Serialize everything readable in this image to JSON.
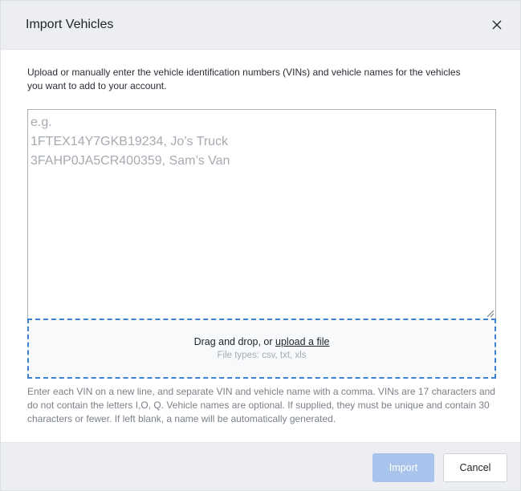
{
  "dialog": {
    "title": "Import Vehicles",
    "close_icon": "close-icon",
    "intro_text": "Upload or manually enter the vehicle identification numbers (VINs) and vehicle names for the vehicles you want to add to your account.",
    "vin_input": {
      "value": "",
      "placeholder": "e.g.\n1FTEX14Y7GKB19234, Jo’s Truck\n3FAHP0JA5CR400359, Sam’s Van"
    },
    "dropzone": {
      "prefix": "Drag and drop, or ",
      "link_label": "upload a file",
      "file_types": "File types: csv, txt, xls"
    },
    "help_text": "Enter each VIN on a new line, and separate VIN and vehicle name with a comma. VINs are 17 characters and do not contain the letters I,O, Q. Vehicle names are optional. If supplied, they must be unique and contain 30 characters or fewer. If left blank, a name will be automatically generated.",
    "footer": {
      "import_label": "Import",
      "cancel_label": "Cancel"
    }
  },
  "colors": {
    "accent": "#3d82d1",
    "import_disabled": "#a9c4ec",
    "header_bg": "#eceef1"
  }
}
